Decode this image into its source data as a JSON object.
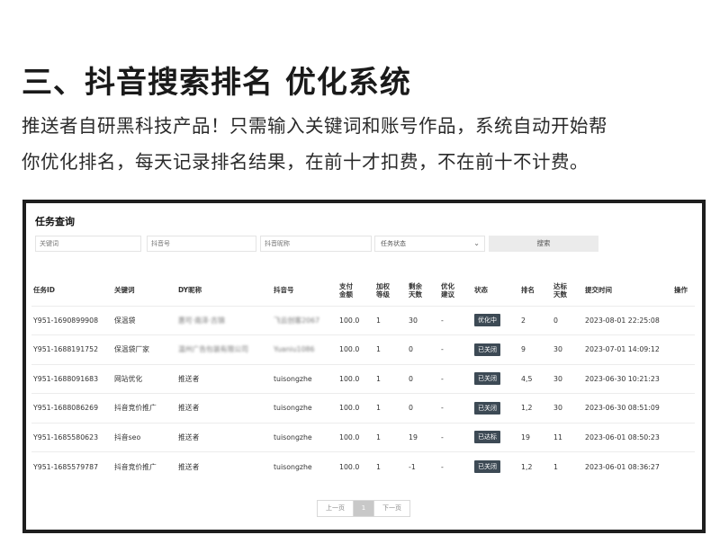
{
  "headline": "三、抖音搜索排名 优化系统",
  "intro": [
    "推送者自研黑科技产品！只需输入关键词和账号作品，系统自动开始帮",
    "你优化排名，每天记录排名结果，在前十才扣费，不在前十不计费。"
  ],
  "panel": {
    "title": "任务查询",
    "filters": {
      "keyword_placeholder": "关键词",
      "douyin_id_placeholder": "抖音号",
      "nickname_placeholder": "抖音昵称",
      "status_select": "任务状态",
      "search_label": "搜索"
    },
    "columns": [
      "任务ID",
      "关键词",
      "DY昵称",
      "抖音号",
      "支付金额",
      "加权等级",
      "剩余天数",
      "优化建议",
      "状态",
      "排名",
      "达标天数",
      "提交时间",
      "操作"
    ],
    "rows": [
      {
        "task_id": "Y951-1690899908",
        "keyword": "保温袋",
        "nickname": "惠可·南泽·古锦",
        "douyin_id": "飞云创客2067",
        "amount": "100.0",
        "weight": "1",
        "days_left": "30",
        "advice": "-",
        "status": "优化中",
        "rank": "2",
        "days_met": "0",
        "submitted": "2023-08-01 22:25:08",
        "action": ""
      },
      {
        "task_id": "Y951-1688191752",
        "keyword": "保温袋厂家",
        "nickname": "温州广告包装有限公司",
        "douyin_id": "Yuaniu1086",
        "amount": "100.0",
        "weight": "1",
        "days_left": "0",
        "advice": "-",
        "status": "已关闭",
        "rank": "9",
        "days_met": "30",
        "submitted": "2023-07-01 14:09:12",
        "action": ""
      },
      {
        "task_id": "Y951-1688091683",
        "keyword": "网站优化",
        "nickname": "推送者",
        "douyin_id": "tuisongzhe",
        "amount": "100.0",
        "weight": "1",
        "days_left": "0",
        "advice": "-",
        "status": "已关闭",
        "rank": "4,5",
        "days_met": "30",
        "submitted": "2023-06-30 10:21:23",
        "action": ""
      },
      {
        "task_id": "Y951-1688086269",
        "keyword": "抖音竞价推广",
        "nickname": "推送者",
        "douyin_id": "tuisongzhe",
        "amount": "100.0",
        "weight": "1",
        "days_left": "0",
        "advice": "-",
        "status": "已关闭",
        "rank": "1,2",
        "days_met": "30",
        "submitted": "2023-06-30 08:51:09",
        "action": ""
      },
      {
        "task_id": "Y951-1685580623",
        "keyword": "抖音seo",
        "nickname": "推送者",
        "douyin_id": "tuisongzhe",
        "amount": "100.0",
        "weight": "1",
        "days_left": "19",
        "advice": "-",
        "status": "已达标",
        "rank": "19",
        "days_met": "11",
        "submitted": "2023-06-01 08:50:23",
        "action": ""
      },
      {
        "task_id": "Y951-1685579787",
        "keyword": "抖音竞价推广",
        "nickname": "推送者",
        "douyin_id": "tuisongzhe",
        "amount": "100.0",
        "weight": "1",
        "days_left": "-1",
        "advice": "-",
        "status": "已关闭",
        "rank": "1,2",
        "days_met": "1",
        "submitted": "2023-06-01 08:36:27",
        "action": ""
      }
    ],
    "pager": {
      "prev": "上一页",
      "current": "1",
      "next": "下一页"
    }
  }
}
